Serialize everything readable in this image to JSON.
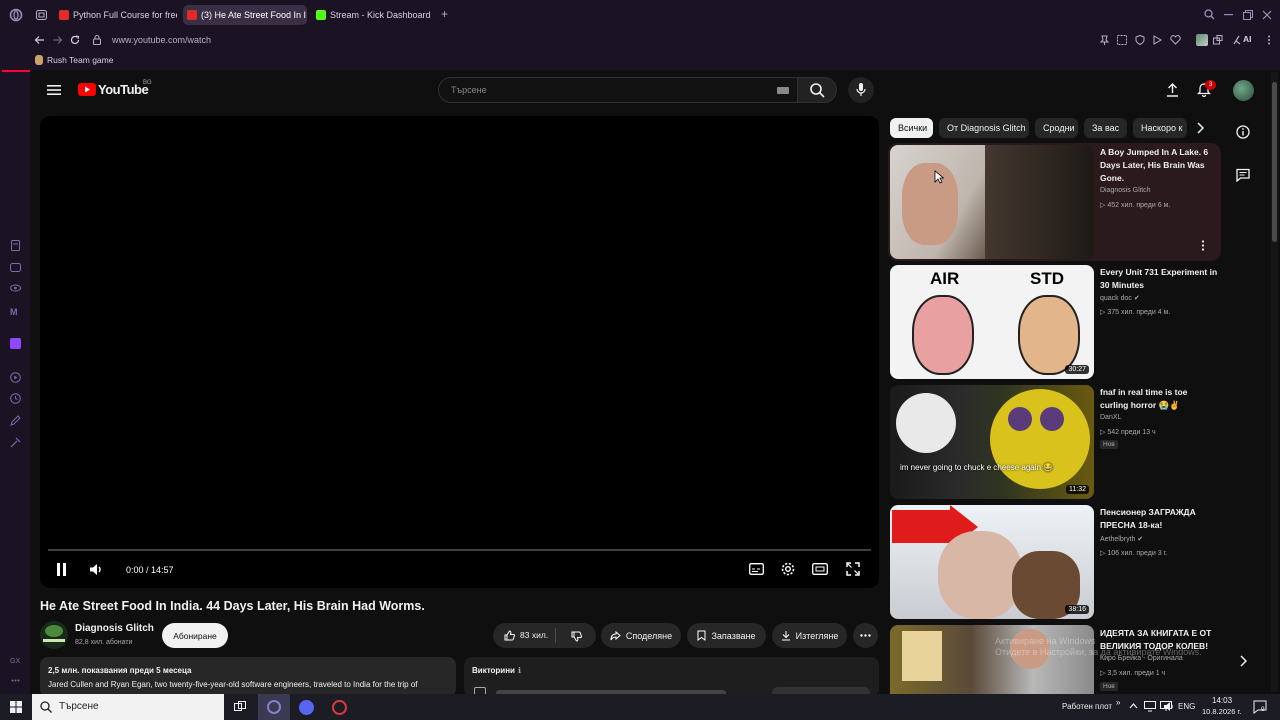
{
  "browser": {
    "tabs": [
      {
        "label": "Python Full Course for free",
        "favicon_color": "#e02b2b"
      },
      {
        "label": "(3) He Ate Street Food In I",
        "favicon_color": "#e02b2b"
      },
      {
        "label": "Stream - Kick Dashboard",
        "favicon_color": "#53fc18"
      }
    ],
    "new_tab": "+",
    "url": "www.youtube.com/watch",
    "bookmark": "Rush Team game",
    "ai_label": "AI"
  },
  "youtube": {
    "logo_text": "YouTube",
    "region": "BG",
    "search_placeholder": "Търсене",
    "notification_count": "3"
  },
  "player": {
    "time": "0:00 / 14:57",
    "progress_fraction": 0.0
  },
  "video": {
    "title": "He Ate Street Food In India. 44 Days Later, His Brain Had Worms.",
    "channel": "Diagnosis Glitch",
    "subscribers": "82,8 хил. абонати",
    "subscribe_label": "Абониране",
    "likes": "83 хил.",
    "share": "Споделяне",
    "save": "Запазване",
    "download": "Изтегляне",
    "desc_meta": "2,5 млн. показвания  преди 5 месеца",
    "desc_text": "Jared Cullen and Ryan Egan, two twenty-five-year-old software engineers, traveled to India for the trip of",
    "quiz_label": "Викторини"
  },
  "chips": [
    "Всички",
    "От Diagnosis Glitch",
    "Сродни",
    "За вас",
    "Наскоро к"
  ],
  "recommendations": [
    {
      "title": "A Boy Jumped In A Lake. 6 Days Later, His Brain Was Gone.",
      "channel": "Diagnosis Glitch",
      "meta": "452 хил.   преди 6 м.",
      "duration": ""
    },
    {
      "title": "Every Unit 731 Experiment in 30 Minutes",
      "channel": "quack doc",
      "meta": "375 хил.   преди 4 м.",
      "duration": "30:27",
      "air": "AIR",
      "std": "STD"
    },
    {
      "title": "fnaf in real time is toe curling horror 😭✌",
      "channel": "DanXL",
      "meta": "542   преди 13 ч",
      "duration": "11:32",
      "badge": "Нов",
      "caption": "im never going to chuck e cheese again 😂"
    },
    {
      "title": "Пенсионер ЗАГРАЖДА ПРЕСНА 18-ка!",
      "channel": "Aethelbryth",
      "meta": "106 хил.   преди 3 г.",
      "duration": "38:16"
    },
    {
      "title": "ИДЕЯТА ЗА КНИГАТА Е ОТ ВЕЛИКИЯ ТОДОР КОЛЕВ!",
      "channel": "Киро Брейка - Оригинала",
      "meta": "3,5 хил.   преди 1 ч",
      "duration": "",
      "badge": "Нов"
    }
  ],
  "windows_watermark": "Активиране на Windows\nОтидете в Настройки, за да активирате Windows.",
  "taskbar": {
    "search": "Търсене",
    "desktop_label": "Работен плот",
    "lang": "ENG",
    "time": "14:03",
    "date": "10.8.2026 г.",
    "notif": "9"
  },
  "colors": {
    "accent": "#ff0000",
    "tab_active": "#3a2f46",
    "chrome": "#1b1324"
  }
}
